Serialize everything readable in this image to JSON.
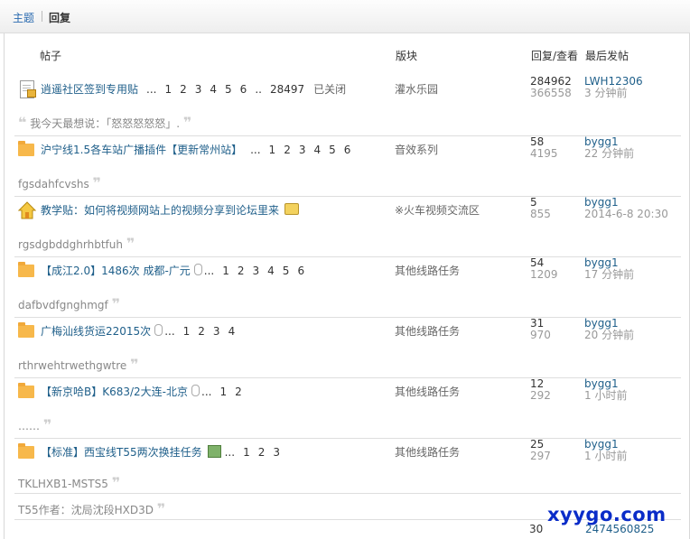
{
  "tabs": {
    "theme": "主题",
    "reply": "回复"
  },
  "headers": {
    "post": "帖子",
    "forum": "版块",
    "stats": "回复/查看",
    "last": "最后发帖"
  },
  "rows": [
    {
      "title": "逍遥社区签到专用贴",
      "pages": [
        "...",
        "1",
        "2",
        "3",
        "4",
        "5",
        "6",
        "..",
        "28497"
      ],
      "closed": "已关闭",
      "forum": "灌水乐园",
      "replies": "284962",
      "views": "366558",
      "user": "LWH12306",
      "time": "3 分钟前",
      "quote": "我今天最想说：「怒怒怒怒怒」.",
      "icon": "closed-doc-icon"
    },
    {
      "title": "沪宁线1.5各车站广播插件【更新常州站】",
      "pages": [
        "...",
        "1",
        "2",
        "3",
        "4",
        "5",
        "6"
      ],
      "forum": "音效系列",
      "replies": "58",
      "views": "4195",
      "user": "bygg1",
      "time": "22 分钟前",
      "quote": "fgsdahfcvshs",
      "icon": "folder-icon"
    },
    {
      "title": "教学贴：如何将视频网站上的视频分享到论坛里来",
      "pages": [],
      "forum": "※火车视频交流区",
      "replies": "5",
      "views": "855",
      "user": "bygg1",
      "time": "2014-6-8 20:30",
      "quote": "rgsdgbddghrhbtfuh",
      "icon": "house-icon"
    },
    {
      "title": "【成江2.0】1486次 成都-广元",
      "pages": [
        "...",
        "1",
        "2",
        "3",
        "4",
        "5",
        "6"
      ],
      "forum": "其他线路任务",
      "replies": "54",
      "views": "1209",
      "user": "bygg1",
      "time": "17 分钟前",
      "quote": "dafbvdfgnghmgf",
      "icon": "folder-icon"
    },
    {
      "title": "广梅汕线货运22015次",
      "pages": [
        "...",
        "1",
        "2",
        "3",
        "4"
      ],
      "forum": "其他线路任务",
      "replies": "31",
      "views": "970",
      "user": "bygg1",
      "time": "20 分钟前",
      "quote": "rthrwehtrwethgwtre",
      "icon": "folder-icon"
    },
    {
      "title": "【新京哈B】K683/2大连-北京",
      "pages": [
        "...",
        "1",
        "2"
      ],
      "forum": "其他线路任务",
      "replies": "12",
      "views": "292",
      "user": "bygg1",
      "time": "1 小时前",
      "quote": "……",
      "icon": "folder-icon"
    },
    {
      "title": "【标准】西宝线T55两次换挂任务",
      "pages": [
        "...",
        "1",
        "2",
        "3"
      ],
      "forum": "其他线路任务",
      "replies": "25",
      "views": "297",
      "user": "bygg1",
      "time": "1 小时前",
      "quote": "TKLHXB1-MSTS5",
      "quote2": "T55作者：沈局沈段HXD3D",
      "icon": "folder-icon"
    }
  ],
  "partial_row": {
    "replies": "30",
    "user": "2474560825"
  },
  "watermark": "xyygo.com"
}
